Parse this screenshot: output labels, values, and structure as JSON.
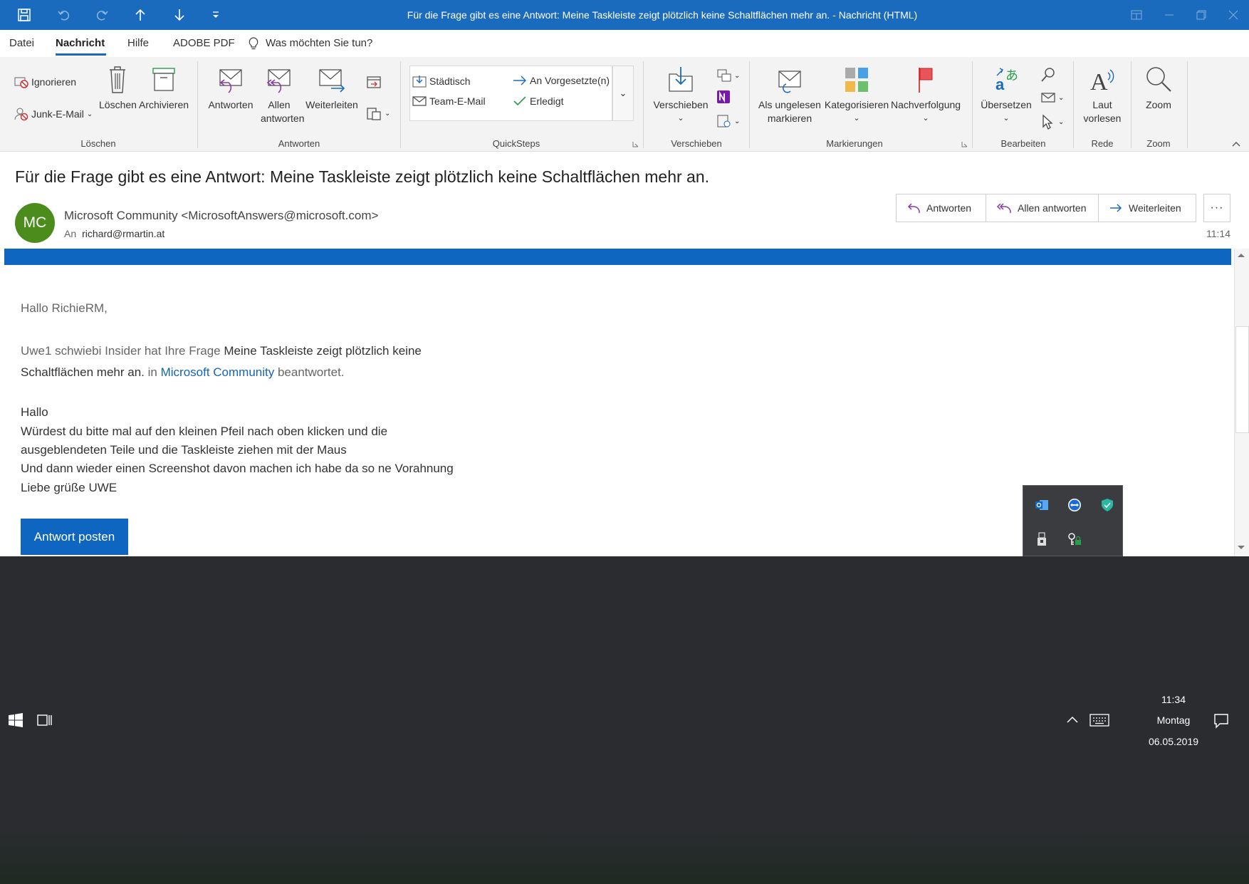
{
  "window": {
    "title": "Für die Frage gibt es eine Antwort: Meine Taskleiste zeigt plötzlich keine Schaltflächen mehr an.  -  Nachricht (HTML)",
    "quick_access_icons": [
      "save-icon",
      "undo-icon",
      "redo-icon",
      "arrow-up-icon",
      "arrow-down-icon",
      "customize-icon"
    ],
    "controls": [
      "ribbon-display-icon",
      "minimize-icon",
      "restore-icon",
      "close-icon"
    ]
  },
  "menu": {
    "items": [
      "Datei",
      "Nachricht",
      "Hilfe",
      "ADOBE PDF"
    ],
    "active": "Nachricht",
    "tell_me": "Was möchten Sie tun?"
  },
  "ribbon": {
    "loeschen": {
      "label": "Löschen",
      "ignore": "Ignorieren",
      "junk": "Junk-E-Mail",
      "delete": "Löschen",
      "archive": "Archivieren"
    },
    "antworten": {
      "label": "Antworten",
      "reply": "Antworten",
      "reply_all_1": "Allen",
      "reply_all_2": "antworten",
      "forward": "Weiterleiten"
    },
    "quicksteps": {
      "label": "QuickSteps",
      "items": [
        "Städtisch",
        "An Vorgesetzte(n)",
        "Team-E-Mail",
        "Erledigt"
      ]
    },
    "verschieben": {
      "label": "Verschieben",
      "move": "Verschieben"
    },
    "markierungen": {
      "label": "Markierungen",
      "unread_1": "Als ungelesen",
      "unread_2": "markieren",
      "categorize": "Kategorisieren",
      "followup": "Nachverfolgung"
    },
    "bearbeiten": {
      "label": "Bearbeiten",
      "translate": "Übersetzen"
    },
    "rede": {
      "label": "Rede",
      "read_1": "Laut",
      "read_2": "vorlesen"
    },
    "zoom": {
      "label": "Zoom",
      "zoom": "Zoom"
    }
  },
  "message": {
    "subject": "Für die Frage gibt es eine Antwort: Meine Taskleiste zeigt plötzlich keine Schaltflächen mehr an.",
    "avatar_initials": "MC",
    "sender": "Microsoft Community <MicrosoftAnswers@microsoft.com>",
    "to_label": "An",
    "to": "richard@rmartin.at",
    "time": "11:14",
    "actions": {
      "reply": "Antworten",
      "reply_all": "Allen antworten",
      "forward": "Weiterleiten",
      "more": "···"
    },
    "body": {
      "greeting": "Hallo RichieRM,",
      "intro_user": "Uwe1 schwiebi Insider hat Ihre Frage",
      "intro_question_1": "Meine Taskleiste zeigt plötzlich keine",
      "intro_question_2": "Schaltflächen mehr an.",
      "intro_in": "in",
      "intro_link": "Microsoft Community",
      "intro_end": "beantwortet.",
      "lines": [
        "Hallo",
        "Würdest du bitte mal auf den kleinen Pfeil nach oben klicken und die",
        "ausgeblendeten Teile und die Taskleiste ziehen mit der Maus",
        "Und dann wieder einen Screenshot davon machen ich habe da so ne Vorahnung",
        "Liebe grüße UWE"
      ],
      "post_button": "Antwort posten"
    }
  },
  "tray_popup": {
    "icons": [
      "outlook-icon",
      "teamviewer-icon",
      "security-shield-icon",
      "usb-device-icon",
      "key-lock-icon"
    ]
  },
  "taskbar": {
    "time": "11:34",
    "day": "Montag",
    "date": "06.05.2019"
  },
  "colors": {
    "title_bar": "#1a6bbd",
    "accent": "#0f66c0",
    "avatar": "#4b8c1c",
    "taskbar": "#2b2c30"
  }
}
